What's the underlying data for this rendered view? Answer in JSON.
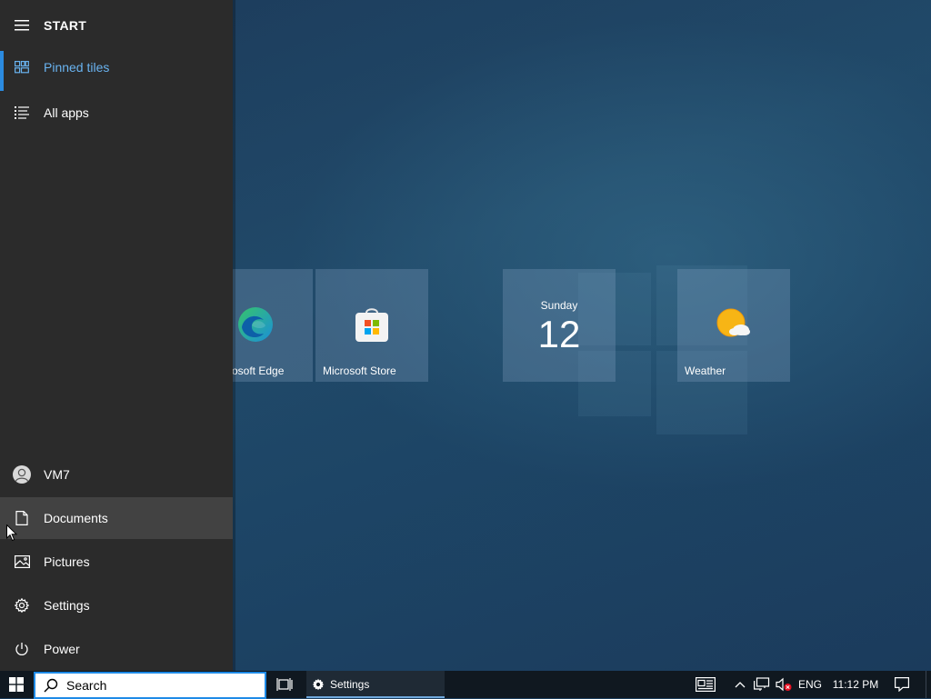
{
  "start": {
    "title": "START",
    "top_items": [
      {
        "label": "Pinned tiles",
        "icon": "tiles-icon",
        "selected": true
      },
      {
        "label": "All apps",
        "icon": "list-icon",
        "selected": false
      }
    ],
    "bottom_items": [
      {
        "label": "VM7",
        "icon": "user-avatar-icon"
      },
      {
        "label": "Documents",
        "icon": "document-icon"
      },
      {
        "label": "Pictures",
        "icon": "pictures-icon"
      },
      {
        "label": "Settings",
        "icon": "gear-icon"
      },
      {
        "label": "Power",
        "icon": "power-icon"
      }
    ]
  },
  "tiles": [
    {
      "label": "osoft Edge",
      "icon": "edge-icon"
    },
    {
      "label": "Microsoft Store",
      "icon": "store-icon"
    },
    {
      "day": "Sunday",
      "date": "12",
      "icon": "calendar-icon"
    },
    {
      "label": "Weather",
      "icon": "weather-icon"
    }
  ],
  "taskbar": {
    "search_placeholder": "Search",
    "open_app": {
      "label": "Settings",
      "icon": "gear-icon"
    },
    "language": "ENG",
    "time": "11:12 PM"
  },
  "colors": {
    "accent": "#2b8be0",
    "selected_text": "#69b3f0",
    "start_bg": "#2b2b2b",
    "taskbar_bg": "#101820"
  }
}
